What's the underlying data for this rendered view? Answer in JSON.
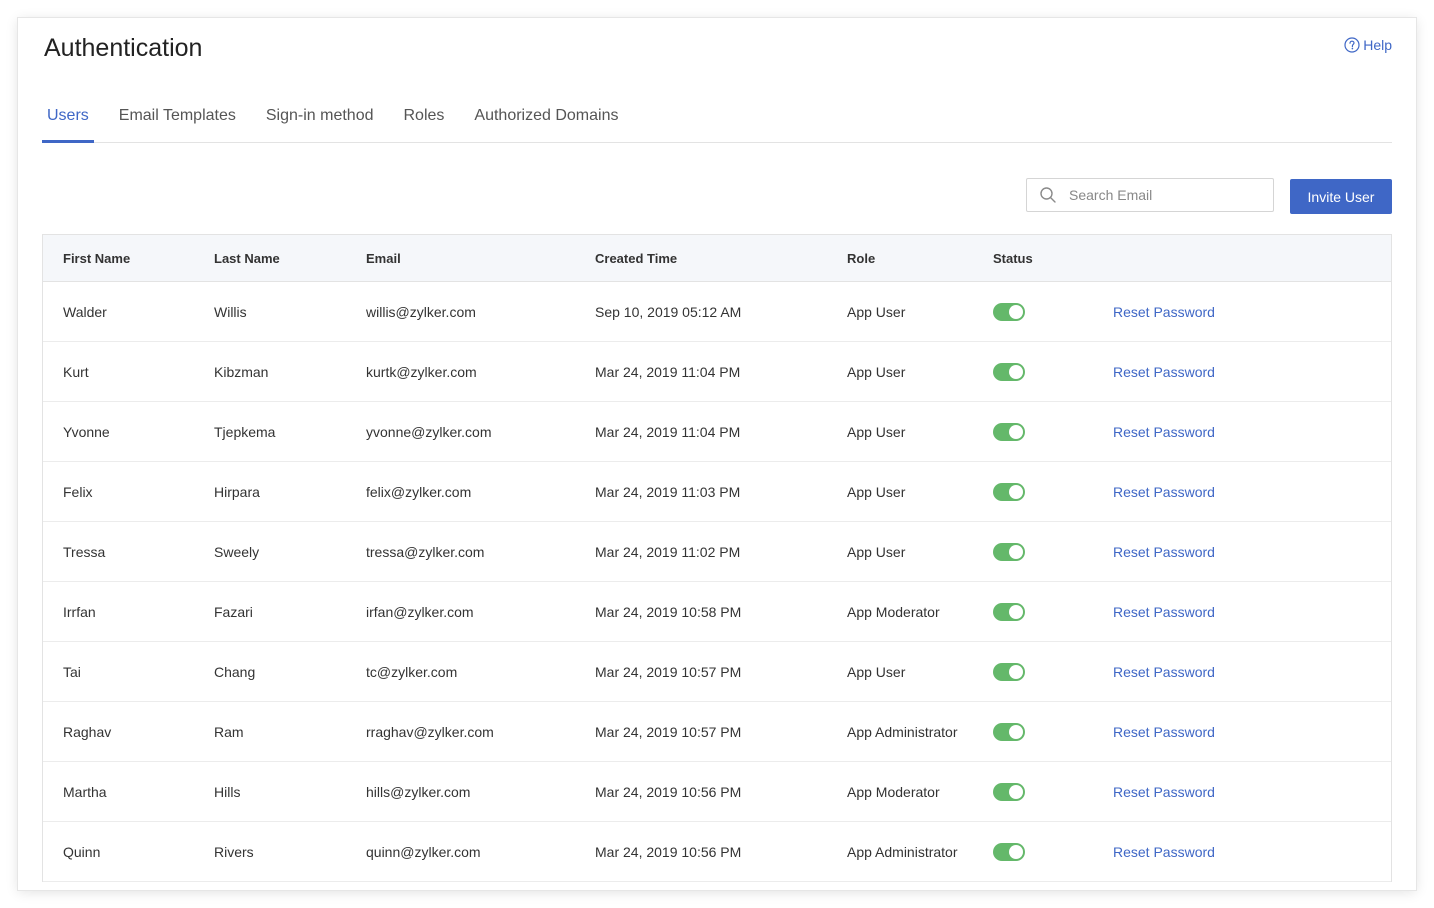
{
  "page": {
    "title": "Authentication",
    "help_label": "Help"
  },
  "tabs": [
    {
      "label": "Users",
      "active": true
    },
    {
      "label": "Email Templates",
      "active": false
    },
    {
      "label": "Sign-in method",
      "active": false
    },
    {
      "label": "Roles",
      "active": false
    },
    {
      "label": "Authorized Domains",
      "active": false
    }
  ],
  "toolbar": {
    "search_placeholder": "Search Email",
    "invite_label": "Invite User"
  },
  "table": {
    "columns": {
      "first_name": "First Name",
      "last_name": "Last Name",
      "email": "Email",
      "created_time": "Created Time",
      "role": "Role",
      "status": "Status"
    },
    "action_label": "Reset Password",
    "rows": [
      {
        "first": "Walder",
        "last": "Willis",
        "email": "willis@zylker.com",
        "created": "Sep 10, 2019 05:12 AM",
        "role": "App User",
        "status_on": true
      },
      {
        "first": "Kurt",
        "last": "Kibzman",
        "email": "kurtk@zylker.com",
        "created": "Mar 24, 2019 11:04 PM",
        "role": "App User",
        "status_on": true
      },
      {
        "first": "Yvonne",
        "last": "Tjepkema",
        "email": "yvonne@zylker.com",
        "created": "Mar 24, 2019 11:04 PM",
        "role": "App User",
        "status_on": true
      },
      {
        "first": "Felix",
        "last": "Hirpara",
        "email": "felix@zylker.com",
        "created": "Mar 24, 2019 11:03 PM",
        "role": "App User",
        "status_on": true
      },
      {
        "first": "Tressa",
        "last": "Sweely",
        "email": "tressa@zylker.com",
        "created": "Mar 24, 2019 11:02 PM",
        "role": "App User",
        "status_on": true
      },
      {
        "first": "Irrfan",
        "last": "Fazari",
        "email": "irfan@zylker.com",
        "created": "Mar 24, 2019 10:58 PM",
        "role": "App Moderator",
        "status_on": true
      },
      {
        "first": "Tai",
        "last": "Chang",
        "email": "tc@zylker.com",
        "created": "Mar 24, 2019 10:57 PM",
        "role": "App User",
        "status_on": true
      },
      {
        "first": "Raghav",
        "last": "Ram",
        "email": "rraghav@zylker.com",
        "created": "Mar 24, 2019 10:57 PM",
        "role": "App Administrator",
        "status_on": true
      },
      {
        "first": "Martha",
        "last": "Hills",
        "email": "hills@zylker.com",
        "created": "Mar 24, 2019 10:56 PM",
        "role": "App Moderator",
        "status_on": true
      },
      {
        "first": "Quinn",
        "last": "Rivers",
        "email": "quinn@zylker.com",
        "created": "Mar 24, 2019 10:56 PM",
        "role": "App Administrator",
        "status_on": true
      }
    ]
  },
  "colors": {
    "accent": "#3f67c6",
    "toggle_on": "#64b86a",
    "header_bg": "#f5f7fa"
  },
  "icons": {
    "help": "question-circle-icon",
    "search": "magnifier-icon"
  }
}
